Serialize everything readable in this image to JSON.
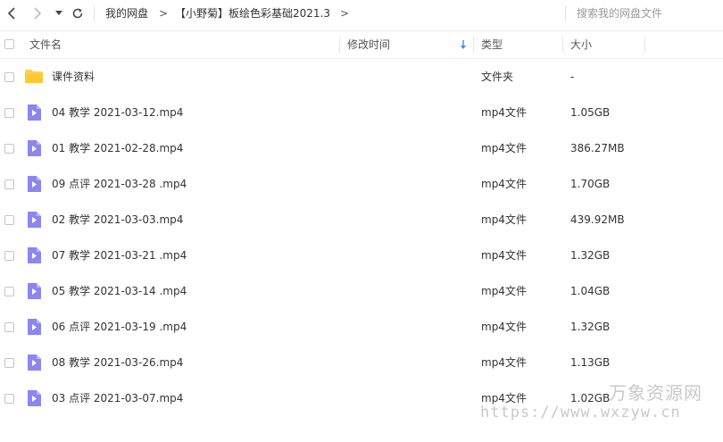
{
  "toolbar": {
    "breadcrumb": [
      {
        "label": "我的网盘"
      },
      {
        "label": "【小野菊】板绘色彩基础2021.3"
      }
    ],
    "search_placeholder": "搜索我的网盘文件"
  },
  "columns": {
    "name": "文件名",
    "modified": "修改时间",
    "type": "类型",
    "size": "大小"
  },
  "files": [
    {
      "name": "课件资料",
      "type": "文件夹",
      "size": "-",
      "icon": "folder-icon"
    },
    {
      "name": "04 教学 2021-03-12.mp4",
      "type": "mp4文件",
      "size": "1.05GB",
      "icon": "video-file-icon"
    },
    {
      "name": "01 教学 2021-02-28.mp4",
      "type": "mp4文件",
      "size": "386.27MB",
      "icon": "video-file-icon"
    },
    {
      "name": "09 点评 2021-03-28 .mp4",
      "type": "mp4文件",
      "size": "1.70GB",
      "icon": "video-file-icon"
    },
    {
      "name": "02 教学 2021-03-03.mp4",
      "type": "mp4文件",
      "size": "439.92MB",
      "icon": "video-file-icon"
    },
    {
      "name": "07 教学 2021-03-21 .mp4",
      "type": "mp4文件",
      "size": "1.32GB",
      "icon": "video-file-icon"
    },
    {
      "name": "05 教学 2021-03-14 .mp4",
      "type": "mp4文件",
      "size": "1.04GB",
      "icon": "video-file-icon"
    },
    {
      "name": "06 点评 2021-03-19 .mp4",
      "type": "mp4文件",
      "size": "1.32GB",
      "icon": "video-file-icon"
    },
    {
      "name": "08 教学 2021-03-26.mp4",
      "type": "mp4文件",
      "size": "1.13GB",
      "icon": "video-file-icon"
    },
    {
      "name": "03 点评 2021-03-07.mp4",
      "type": "mp4文件",
      "size": "1.02GB",
      "icon": "video-file-icon"
    }
  ],
  "watermark": {
    "title": "万象资源网",
    "url": "https://www.wxzyw.cn"
  },
  "colors": {
    "video_icon": "#8c86f0",
    "folder_icon": "#ffd152",
    "sort_arrow": "#2f8dfa"
  }
}
